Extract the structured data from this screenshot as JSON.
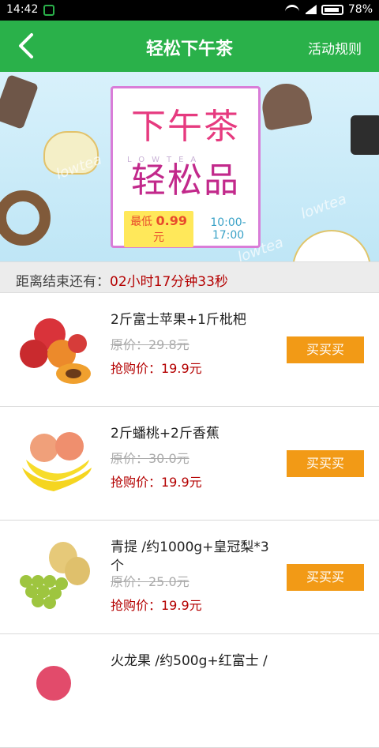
{
  "status": {
    "time": "14:42",
    "battery": "78%"
  },
  "header": {
    "title": "轻松下午茶",
    "rules_label": "活动规则"
  },
  "banner": {
    "line1": "下午茶",
    "line2": "轻松品",
    "subtitle": "LOWTEA",
    "price_prefix": "最低",
    "price_value": "0.99",
    "price_unit": "元",
    "hours": "10:00-17:00",
    "watermark": "lowtea"
  },
  "countdown": {
    "label": "距离结束还有：",
    "value": "02小时17分钟33秒"
  },
  "products": [
    {
      "name": "2斤富士苹果+1斤枇杷",
      "original": "原价：29.8元",
      "sale": "抢购价：19.9元",
      "button": "买买买"
    },
    {
      "name": "2斤蟠桃+2斤香蕉",
      "original": "原价：30.0元",
      "sale": "抢购价：19.9元",
      "button": "买买买"
    },
    {
      "name": "青提 /约1000g+皇冠梨*3个",
      "original": "原价：25.0元",
      "sale": "抢购价：19.9元",
      "button": "买买买"
    },
    {
      "name": "火龙果 /约500g+红富士 /",
      "original": "",
      "sale": "",
      "button": ""
    }
  ]
}
